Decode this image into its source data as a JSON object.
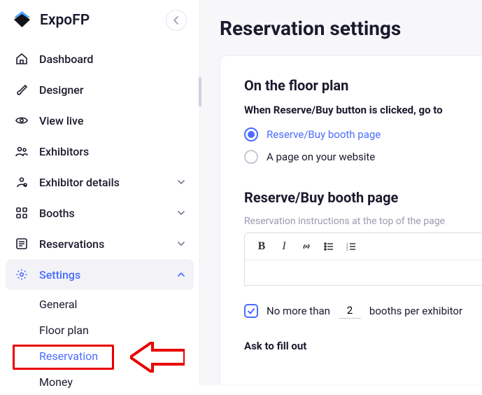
{
  "brand": "ExpoFP",
  "sidebar": {
    "items": [
      {
        "label": "Dashboard"
      },
      {
        "label": "Designer"
      },
      {
        "label": "View live"
      },
      {
        "label": "Exhibitors"
      },
      {
        "label": "Exhibitor details"
      },
      {
        "label": "Booths"
      },
      {
        "label": "Reservations"
      },
      {
        "label": "Settings"
      }
    ],
    "settings_children": [
      {
        "label": "General"
      },
      {
        "label": "Floor plan"
      },
      {
        "label": "Reservation"
      },
      {
        "label": "Money"
      }
    ]
  },
  "main": {
    "title": "Reservation settings",
    "floor_section": {
      "heading": "On the floor plan",
      "subheading": "When Reserve/Buy button is clicked, go to",
      "options": [
        "Reserve/Buy booth page",
        "A page on your website"
      ]
    },
    "booth_section": {
      "heading": "Reserve/Buy booth page",
      "caption": "Reservation instructions at the top of the page"
    },
    "limit": {
      "prefix": "No more than",
      "value": "2",
      "suffix": "booths per exhibitor"
    },
    "ask_heading": "Ask to fill out"
  }
}
